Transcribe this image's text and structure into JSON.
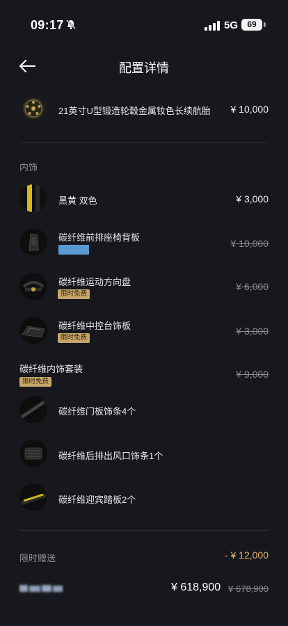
{
  "status": {
    "time": "09:17",
    "network": "5G",
    "battery": "69"
  },
  "header": {
    "title": "配置详情"
  },
  "wheel": {
    "label": "21英寸U型锻造轮毂金属钕色长续航胎",
    "price": "¥ 10,000"
  },
  "interior": {
    "section_label": "内饰",
    "items": [
      {
        "label": "黑黄 双色",
        "price": "¥ 3,000"
      },
      {
        "label": "碳纤维前排座椅背板",
        "price": "¥ 10,000",
        "swatch_color": "#5b9ad1"
      },
      {
        "label": "碳纤维运动方向盘",
        "price": "¥ 6,000",
        "badge": "限时免费"
      },
      {
        "label": "碳纤维中控台饰板",
        "price": "¥ 3,000",
        "badge": "限时免费"
      }
    ],
    "package": {
      "label": "碳纤维内饰套装",
      "price": "¥ 9,000",
      "badge": "限时免费",
      "items": [
        {
          "label": "碳纤维门板饰条4个"
        },
        {
          "label": "碳纤维后排出风口饰条1个"
        },
        {
          "label": "碳纤维迎宾踏板2个"
        }
      ]
    }
  },
  "gift": {
    "label": "限时赠送",
    "price": "- ¥ 12,000"
  },
  "footer": {
    "total": "¥ 618,900",
    "original": "¥ 678,900"
  },
  "colors": {
    "background": "#17181d",
    "badge": "#c7a56a",
    "gift": "#e7b266"
  }
}
